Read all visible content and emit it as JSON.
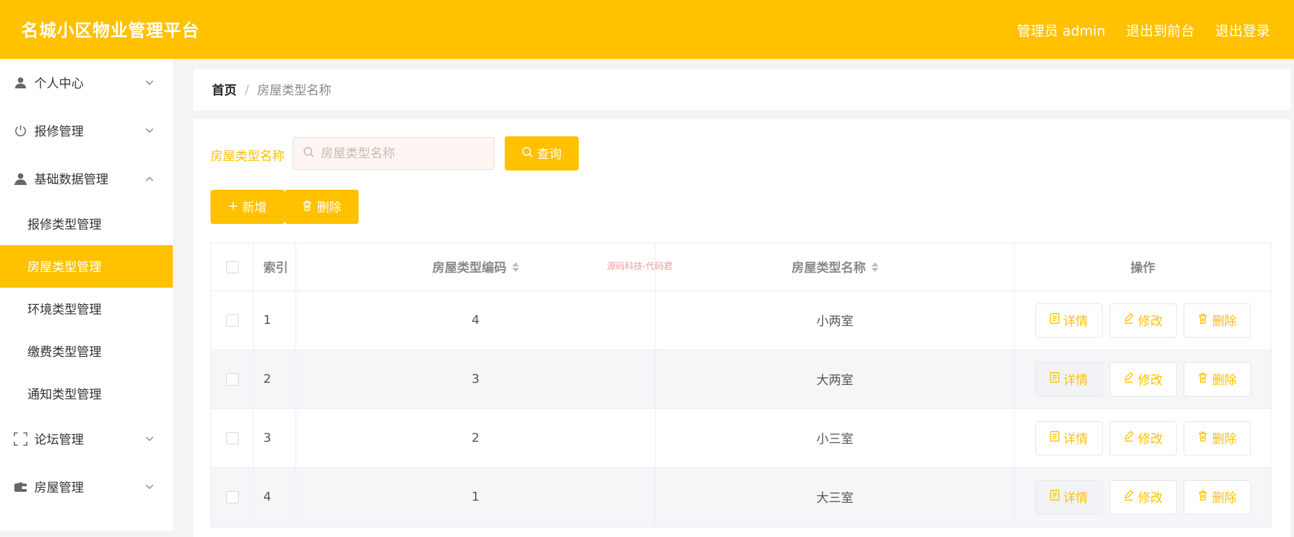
{
  "header": {
    "title": "名城小区物业管理平台",
    "admin_label": "管理员 admin",
    "to_front_label": "退出到前台",
    "logout_label": "退出登录"
  },
  "sidebar": {
    "items": [
      {
        "label": "个人中心",
        "icon": "user-icon",
        "expanded": false
      },
      {
        "label": "报修管理",
        "icon": "power-icon",
        "expanded": false
      },
      {
        "label": "基础数据管理",
        "icon": "user-group-icon",
        "expanded": true
      }
    ],
    "subitems": [
      {
        "label": "报修类型管理",
        "active": false
      },
      {
        "label": "房屋类型管理",
        "active": true
      },
      {
        "label": "环境类型管理",
        "active": false
      },
      {
        "label": "缴费类型管理",
        "active": false
      },
      {
        "label": "通知类型管理",
        "active": false
      }
    ],
    "items_after": [
      {
        "label": "论坛管理",
        "icon": "frame-icon",
        "expanded": false
      },
      {
        "label": "房屋管理",
        "icon": "wallet-icon",
        "expanded": false
      }
    ]
  },
  "breadcrumb": {
    "home": "首页",
    "separator": "/",
    "current": "房屋类型名称"
  },
  "search": {
    "label": "房屋类型名称",
    "placeholder": "房屋类型名称",
    "value": "",
    "query_label": "查询"
  },
  "actions": {
    "add_label": "新增",
    "delete_label": "删除"
  },
  "table": {
    "headers": {
      "index": "索引",
      "code": "房屋类型编码",
      "name": "房屋类型名称",
      "ops": "操作"
    },
    "rows": [
      {
        "index": "1",
        "code": "4",
        "name": "小两室"
      },
      {
        "index": "2",
        "code": "3",
        "name": "大两室"
      },
      {
        "index": "3",
        "code": "2",
        "name": "小三室"
      },
      {
        "index": "4",
        "code": "1",
        "name": "大三室"
      }
    ],
    "op_labels": {
      "detail": "详情",
      "edit": "修改",
      "delete": "删除"
    }
  },
  "watermark": "源码科技-代码君",
  "colors": {
    "accent": "#ffc100",
    "sidebar_bg": "#ffffff",
    "page_bg": "#f4f4f5"
  }
}
